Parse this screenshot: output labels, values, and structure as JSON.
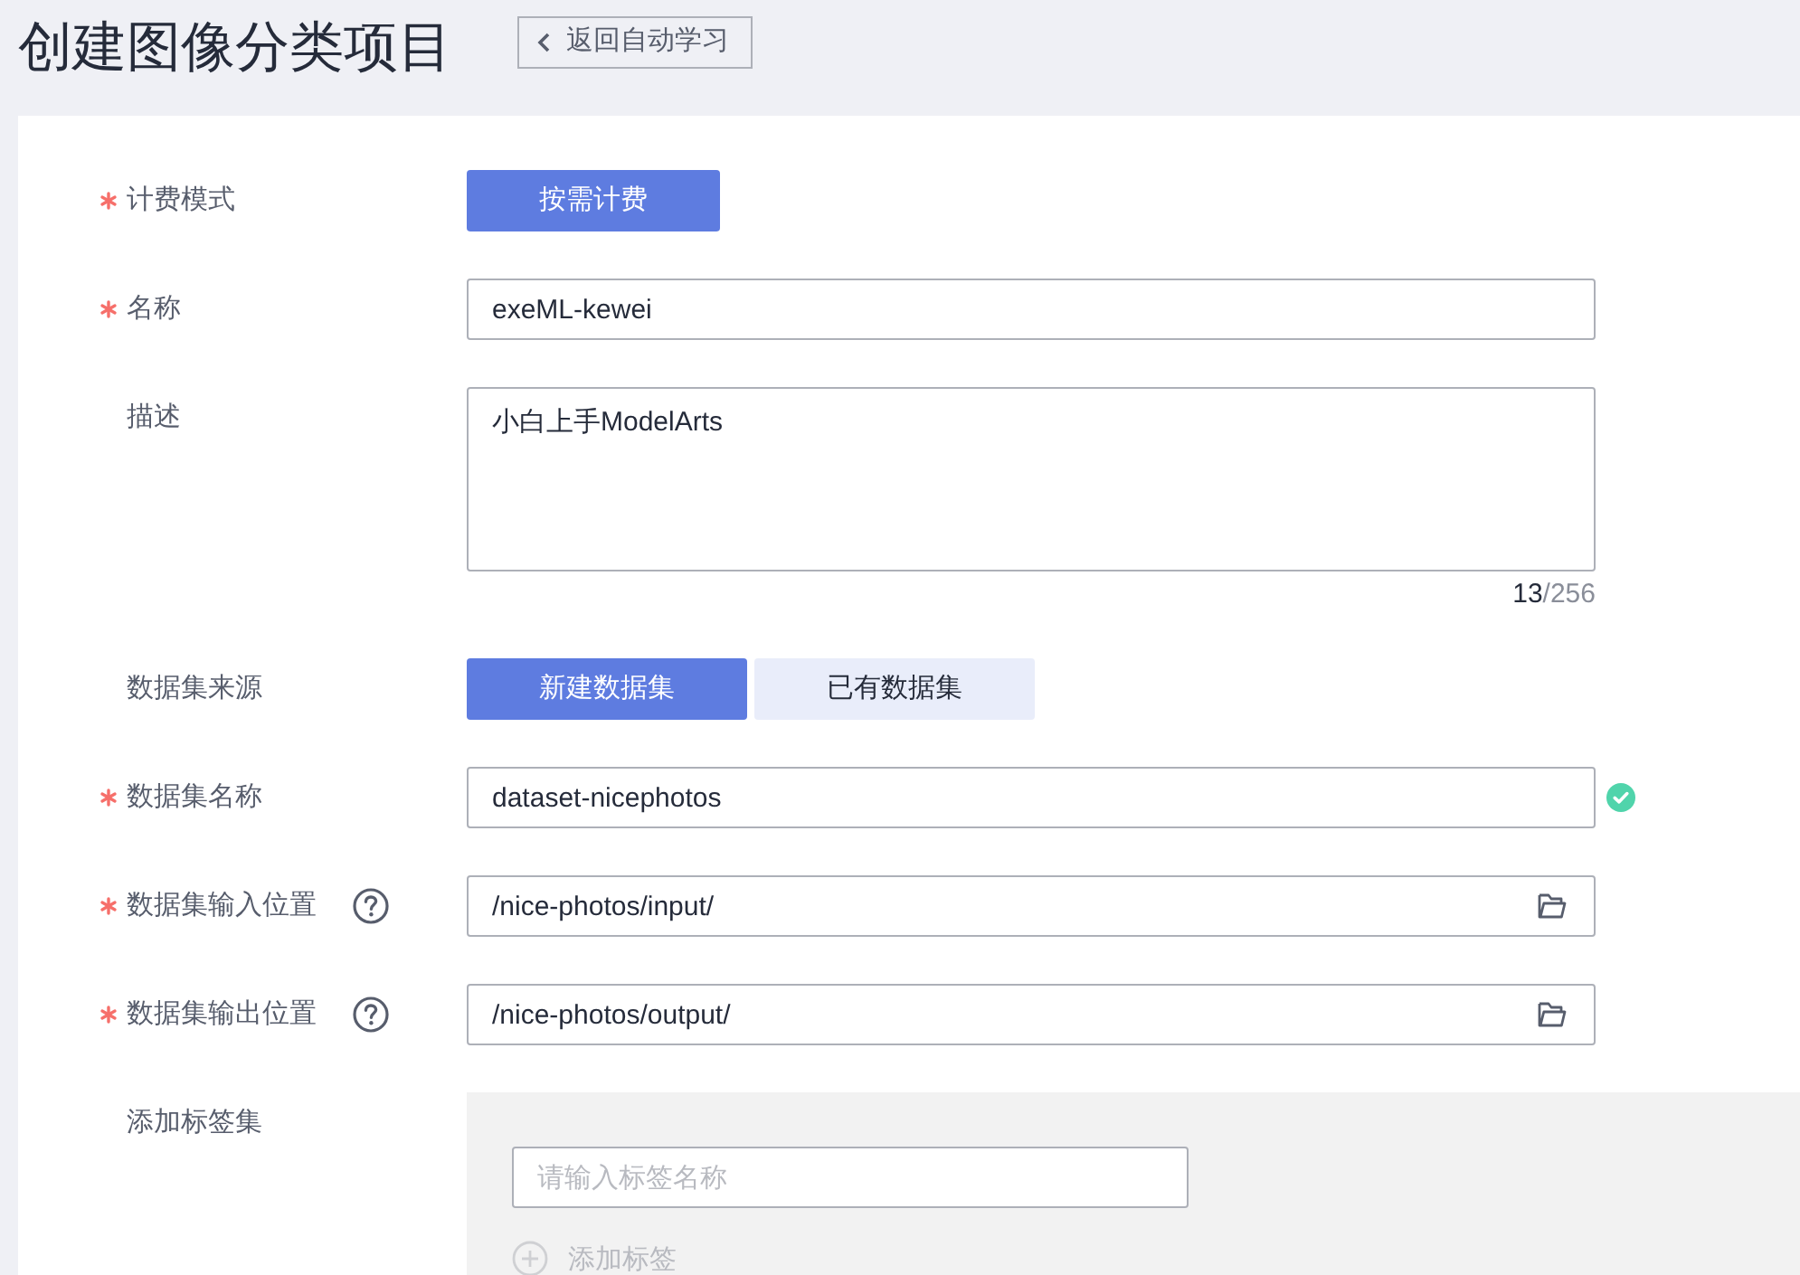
{
  "header": {
    "title": "创建图像分类项目",
    "back_button": "返回自动学习"
  },
  "form": {
    "fields": [
      {
        "kind": "choice",
        "label": "计费模式",
        "required": true,
        "help": false,
        "valid": false,
        "options": [
          {
            "label": "按需计费",
            "selected": true
          }
        ]
      },
      {
        "kind": "text",
        "label": "名称",
        "required": true,
        "help": false,
        "valid": false,
        "value": "exeML-kewei"
      },
      {
        "kind": "textarea",
        "label": "描述",
        "required": false,
        "help": false,
        "valid": false,
        "value": "小白上手ModelArts",
        "counter": {
          "count": "13",
          "limit": "/256"
        }
      },
      {
        "kind": "choice",
        "label": "数据集来源",
        "required": false,
        "help": false,
        "valid": false,
        "options": [
          {
            "label": "新建数据集",
            "selected": true
          },
          {
            "label": "已有数据集",
            "selected": false
          }
        ]
      },
      {
        "kind": "text",
        "label": "数据集名称",
        "required": true,
        "help": false,
        "valid": true,
        "value": "dataset-nicephotos"
      },
      {
        "kind": "path",
        "label": "数据集输入位置",
        "required": true,
        "help": true,
        "valid": false,
        "value": "/nice-photos/input/"
      },
      {
        "kind": "path",
        "label": "数据集输出位置",
        "required": true,
        "help": true,
        "valid": false,
        "value": "/nice-photos/output/"
      },
      {
        "kind": "tags",
        "label": "添加标签集",
        "required": false,
        "help": false,
        "valid": false,
        "tag_input": {
          "placeholder": "请输入标签名称"
        },
        "add_button": "添加标签"
      }
    ]
  }
}
